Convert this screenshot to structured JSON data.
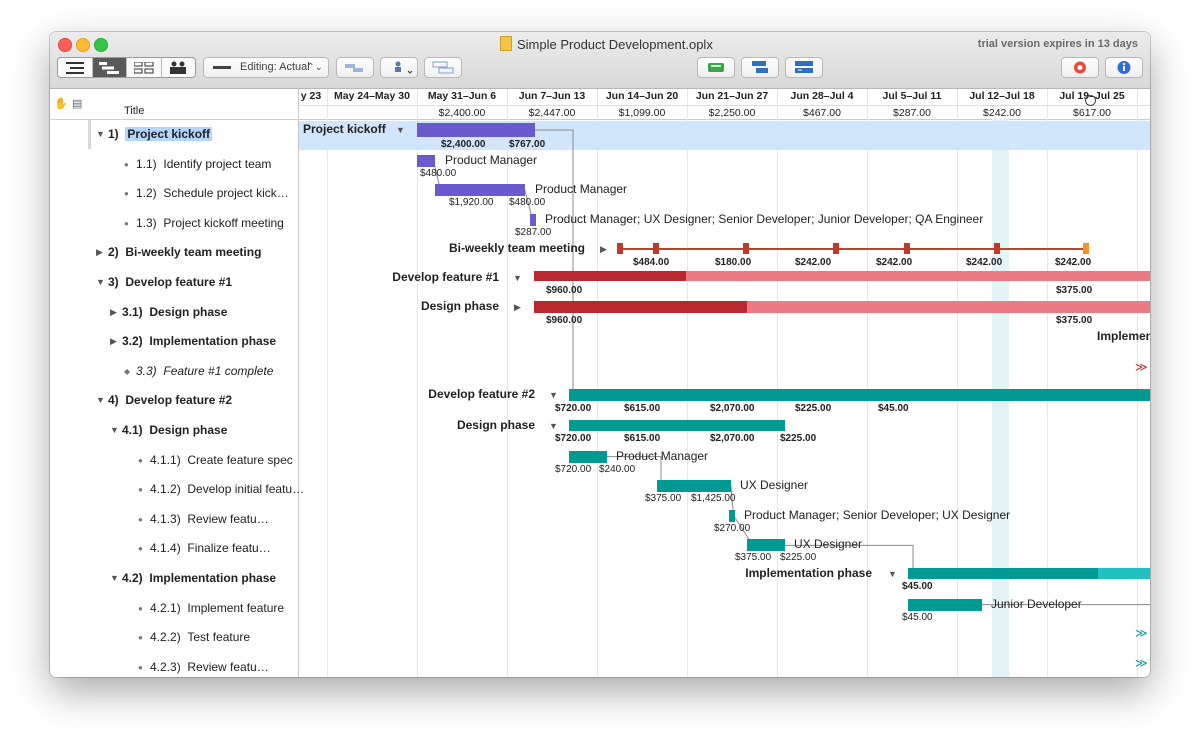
{
  "window": {
    "title": "Simple Product Development.oplx",
    "trial": "trial version expires in 13 days"
  },
  "toolbar": {
    "view_modes": [
      "outline-view",
      "gantt-view",
      "network-view",
      "resource-view"
    ],
    "editing_label": "Editing: Actual"
  },
  "outline": {
    "title_header": "Title"
  },
  "rows": [
    {
      "num": "1)",
      "title": "Project kickoff",
      "level": 0,
      "kind": "group",
      "expanded": true
    },
    {
      "num": "1.1)",
      "title": "Identify project team",
      "level": 1,
      "kind": "task"
    },
    {
      "num": "1.2)",
      "title": "Schedule project kick…",
      "level": 1,
      "kind": "task"
    },
    {
      "num": "1.3)",
      "title": "Project kickoff meeting",
      "level": 1,
      "kind": "task"
    },
    {
      "num": "2)",
      "title": "Bi-weekly team meeting",
      "level": 0,
      "kind": "group",
      "expanded": false
    },
    {
      "num": "3)",
      "title": "Develop feature #1",
      "level": 0,
      "kind": "group",
      "expanded": true
    },
    {
      "num": "3.1)",
      "title": "Design phase",
      "level": 1,
      "kind": "group",
      "expanded": false
    },
    {
      "num": "3.2)",
      "title": "Implementation phase",
      "level": 1,
      "kind": "group",
      "expanded": false
    },
    {
      "num": "3.3)",
      "title": "Feature #1 complete",
      "level": 1,
      "kind": "milestone"
    },
    {
      "num": "4)",
      "title": "Develop feature #2",
      "level": 0,
      "kind": "group",
      "expanded": true
    },
    {
      "num": "4.1)",
      "title": "Design phase",
      "level": 1,
      "kind": "group",
      "expanded": true
    },
    {
      "num": "4.1.1)",
      "title": "Create feature spec",
      "level": 2,
      "kind": "task"
    },
    {
      "num": "4.1.2)",
      "title": "Develop initial featu…",
      "level": 2,
      "kind": "task"
    },
    {
      "num": "4.1.3)",
      "title": "Review featu…",
      "level": 2,
      "kind": "task"
    },
    {
      "num": "4.1.4)",
      "title": "Finalize featu…",
      "level": 2,
      "kind": "task"
    },
    {
      "num": "4.2)",
      "title": "Implementation phase",
      "level": 1,
      "kind": "group",
      "expanded": true
    },
    {
      "num": "4.2.1)",
      "title": "Implement feature",
      "level": 2,
      "kind": "task"
    },
    {
      "num": "4.2.2)",
      "title": "Test feature",
      "level": 2,
      "kind": "task"
    },
    {
      "num": "4.2.3)",
      "title": "Review featu…",
      "level": 2,
      "kind": "task"
    }
  ],
  "timeline": {
    "weeks": [
      "y 23",
      "May 24–May 30",
      "May 31–Jun 6",
      "Jun 7–Jun 13",
      "Jun 14–Jun 20",
      "Jun 21–Jun 27",
      "Jun 28–Jul 4",
      "Jul 5–Jul 11",
      "Jul 12–Jul 18",
      "Jul 19–Jul 25"
    ],
    "week_costs": [
      "",
      "",
      "$2,400.00",
      "$2,447.00",
      "$1,099.00",
      "$2,250.00",
      "$467.00",
      "$287.00",
      "$242.00",
      "$617.00"
    ]
  },
  "gantt": {
    "labels": {
      "project_kickoff": "Project kickoff",
      "pm": "Product Manager",
      "pm2": "Product Manager",
      "team": "Product Manager; UX Designer; Senior Developer; Junior Developer; QA Engineer",
      "biweekly": "Bi-weekly team meeting",
      "dev1": "Develop feature #1",
      "design1": "Design phase",
      "impl1": "Implemen",
      "dev2": "Develop feature #2",
      "design2": "Design phase",
      "pm3": "Product Manager",
      "ux1": "UX Designer",
      "team2": "Product Manager; Senior Developer; UX Designer",
      "ux2": "UX Designer",
      "impl2": "Implementation phase",
      "jd": "Junior Developer"
    },
    "amounts": {
      "pk1": "$2,400.00",
      "pk2": "$767.00",
      "t11": "$480.00",
      "t12a": "$1,920.00",
      "t12b": "$480.00",
      "t13": "$287.00",
      "bw1": "$484.00",
      "bw2": "$180.00",
      "bw3": "$242.00",
      "bw4": "$242.00",
      "bw5": "$242.00",
      "bw6": "$242.00",
      "d1a": "$960.00",
      "d1b": "$375.00",
      "ds1a": "$960.00",
      "ds1b": "$375.00",
      "d2a": "$720.00",
      "d2b": "$615.00",
      "d2c": "$2,070.00",
      "d2d": "$225.00",
      "d2e": "$45.00",
      "ds2a": "$720.00",
      "ds2b": "$615.00",
      "ds2c": "$2,070.00",
      "ds2d": "$225.00",
      "c1a": "$720.00",
      "c1b": "$240.00",
      "c2a": "$375.00",
      "c2b": "$1,425.00",
      "c3": "$270.00",
      "c4a": "$375.00",
      "c4b": "$225.00",
      "ip": "$45.00",
      "if": "$45.00"
    },
    "colors": {
      "kickoff": "#6a5acd",
      "feature1": "#b8282f",
      "feature1_light": "#ec7a85",
      "feature2": "#009a93",
      "feature2_light": "#1fc2c0",
      "meeting": "#c0392b",
      "meeting_end": "#f0932b",
      "selection_band": "#d1e5fb",
      "today": "#e2f4f6"
    }
  }
}
